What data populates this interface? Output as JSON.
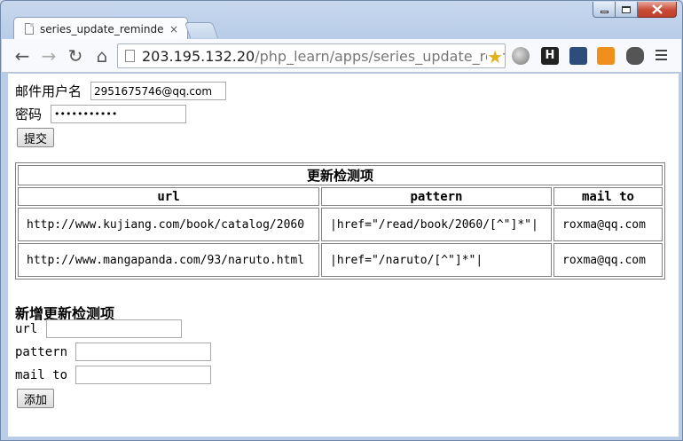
{
  "browser": {
    "tab_title": "series_update_reminder",
    "tab_close": "×",
    "url_host": "203.195.132.20",
    "url_path": "/php_learn/apps/series_update_rem",
    "nav": {
      "back": "←",
      "forward": "→",
      "reload": "↻",
      "home": "⌂"
    },
    "star": "★",
    "ext_h": "H"
  },
  "login": {
    "username_label": "邮件用户名",
    "username_value": "2951675746@qq.com",
    "password_label": "密码",
    "password_value": "•••••••••••",
    "submit_label": "提交"
  },
  "table": {
    "caption": "更新检测项",
    "headers": [
      "url",
      "pattern",
      "mail to"
    ],
    "rows": [
      {
        "url": "http://www.kujiang.com/book/catalog/2060",
        "pattern": "|href=\"/read/book/2060/[^\"]*\"|",
        "mail_to": "roxma@qq.com"
      },
      {
        "url": "http://www.mangapanda.com/93/naruto.html",
        "pattern": "|href=\"/naruto/[^\"]*\"|",
        "mail_to": "roxma@qq.com"
      }
    ]
  },
  "add_form": {
    "title": "新增更新检测项",
    "url_label": "url",
    "pattern_label": "pattern",
    "mailto_label": "mail to",
    "submit_label": "添加"
  }
}
